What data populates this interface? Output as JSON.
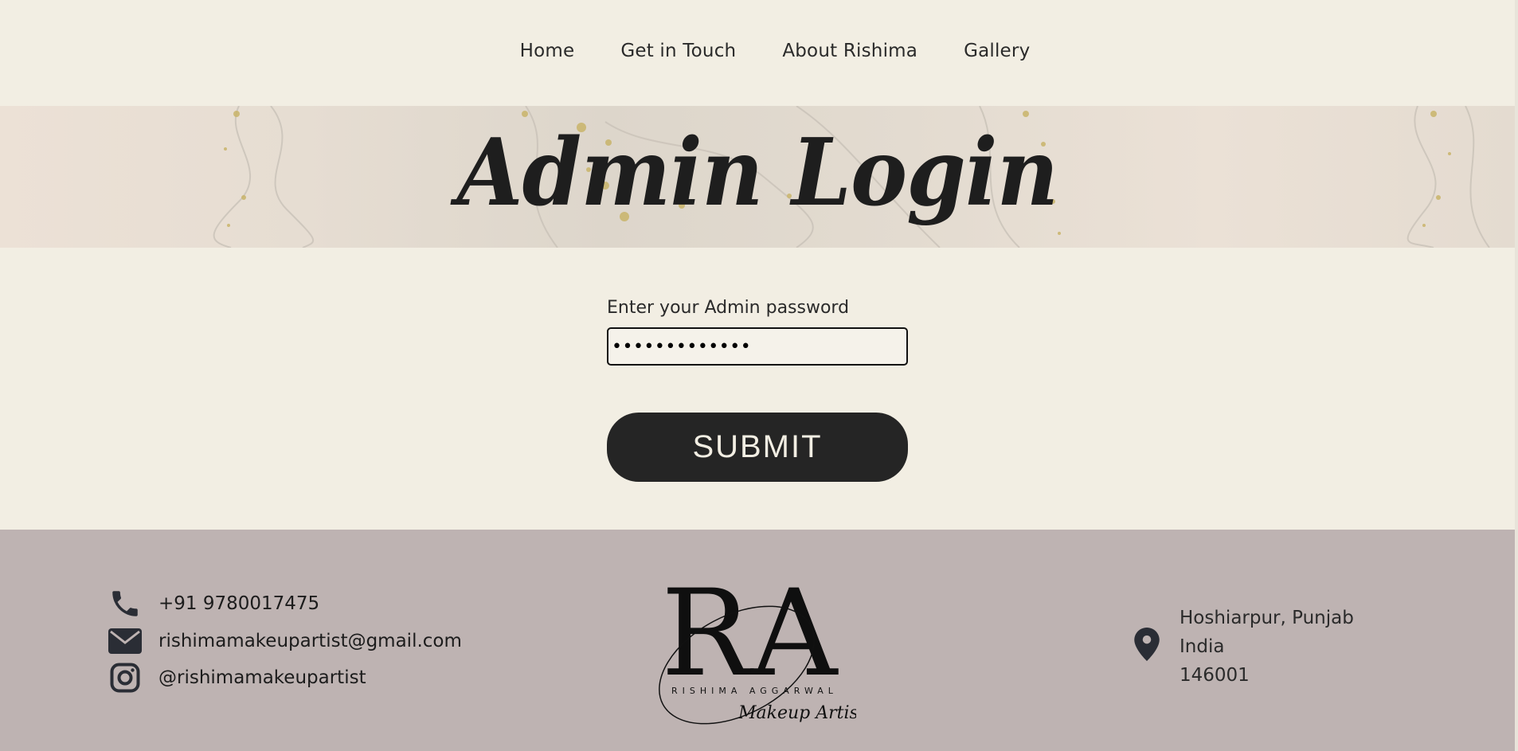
{
  "nav": {
    "items": [
      {
        "label": "Home"
      },
      {
        "label": "Get in Touch"
      },
      {
        "label": "About Rishima"
      },
      {
        "label": "Gallery"
      }
    ]
  },
  "hero": {
    "title": "Admin Login"
  },
  "login_form": {
    "password_label": "Enter your Admin password",
    "password_value": "•••••••••••••",
    "submit_label": "SUBMIT"
  },
  "footer": {
    "contacts": [
      {
        "icon": "phone-icon",
        "text": "+91 9780017475"
      },
      {
        "icon": "envelope-icon",
        "text": "rishimamakeupartist@gmail.com"
      },
      {
        "icon": "instagram-icon",
        "text": "@rishimamakeupartist"
      }
    ],
    "logo": {
      "monogram": "RA",
      "name": "RISHIMA AGGARWAL",
      "tagline": "Makeup Artist"
    },
    "address": {
      "icon": "map-pin-icon",
      "line1": "Hoshiarpur, Punjab",
      "line2": "India",
      "line3": "146001"
    }
  },
  "colors": {
    "page_bg": "#f2eee3",
    "footer_bg": "#beb3b2",
    "button_bg": "#252525",
    "text": "#222222"
  }
}
